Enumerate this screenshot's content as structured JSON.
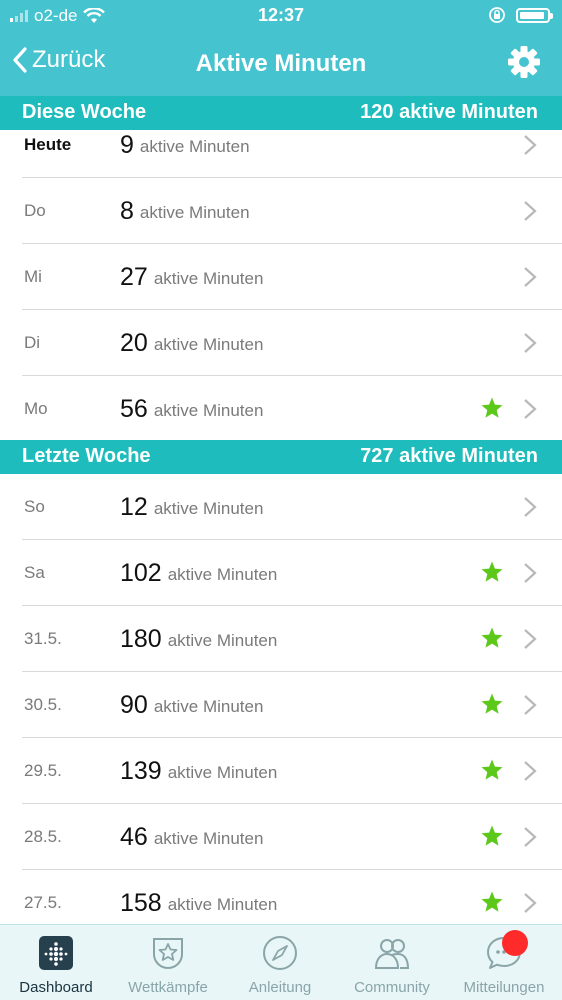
{
  "status": {
    "carrier": "o2-de",
    "time": "12:37"
  },
  "nav": {
    "back_label": "Zurück",
    "title": "Aktive Minuten"
  },
  "unit_label": "aktive Minuten",
  "this_week": {
    "label": "Diese Woche",
    "total": "120 aktive Minuten",
    "rows": [
      {
        "day": "Heute",
        "value": "9",
        "unit": "aktive Minuten",
        "star": false
      },
      {
        "day": "Do",
        "value": "8",
        "unit": "aktive Minuten",
        "star": false
      },
      {
        "day": "Mi",
        "value": "27",
        "unit": "aktive Minuten",
        "star": false
      },
      {
        "day": "Di",
        "value": "20",
        "unit": "aktive Minuten",
        "star": false
      },
      {
        "day": "Mo",
        "value": "56",
        "unit": "aktive Minuten",
        "star": true
      }
    ]
  },
  "last_week": {
    "label": "Letzte Woche",
    "total": "727 aktive Minuten",
    "rows": [
      {
        "day": "So",
        "value": "12",
        "unit": "aktive Minuten",
        "star": false
      },
      {
        "day": "Sa",
        "value": "102",
        "unit": "aktive Minuten",
        "star": true
      },
      {
        "day": "31.5.",
        "value": "180",
        "unit": "aktive Minuten",
        "star": true
      },
      {
        "day": "30.5.",
        "value": "90",
        "unit": "aktive Minuten",
        "star": true
      },
      {
        "day": "29.5.",
        "value": "139",
        "unit": "aktive Minuten",
        "star": true
      },
      {
        "day": "28.5.",
        "value": "46",
        "unit": "aktive Minuten",
        "star": true
      },
      {
        "day": "27.5.",
        "value": "158",
        "unit": "aktive Minuten",
        "star": true
      }
    ]
  },
  "tabs": [
    {
      "label": "Dashboard",
      "icon": "dashboard-icon"
    },
    {
      "label": "Wettkämpfe",
      "icon": "challenges-icon"
    },
    {
      "label": "Anleitung",
      "icon": "compass-icon"
    },
    {
      "label": "Community",
      "icon": "community-icon"
    },
    {
      "label": "Mitteilungen",
      "icon": "messages-icon"
    }
  ],
  "colors": {
    "header": "#45c4cf",
    "section": "#1ebcbc",
    "star": "#5cc91a",
    "badge": "#ff2b2b",
    "tabbar": "#e8f6f7"
  }
}
